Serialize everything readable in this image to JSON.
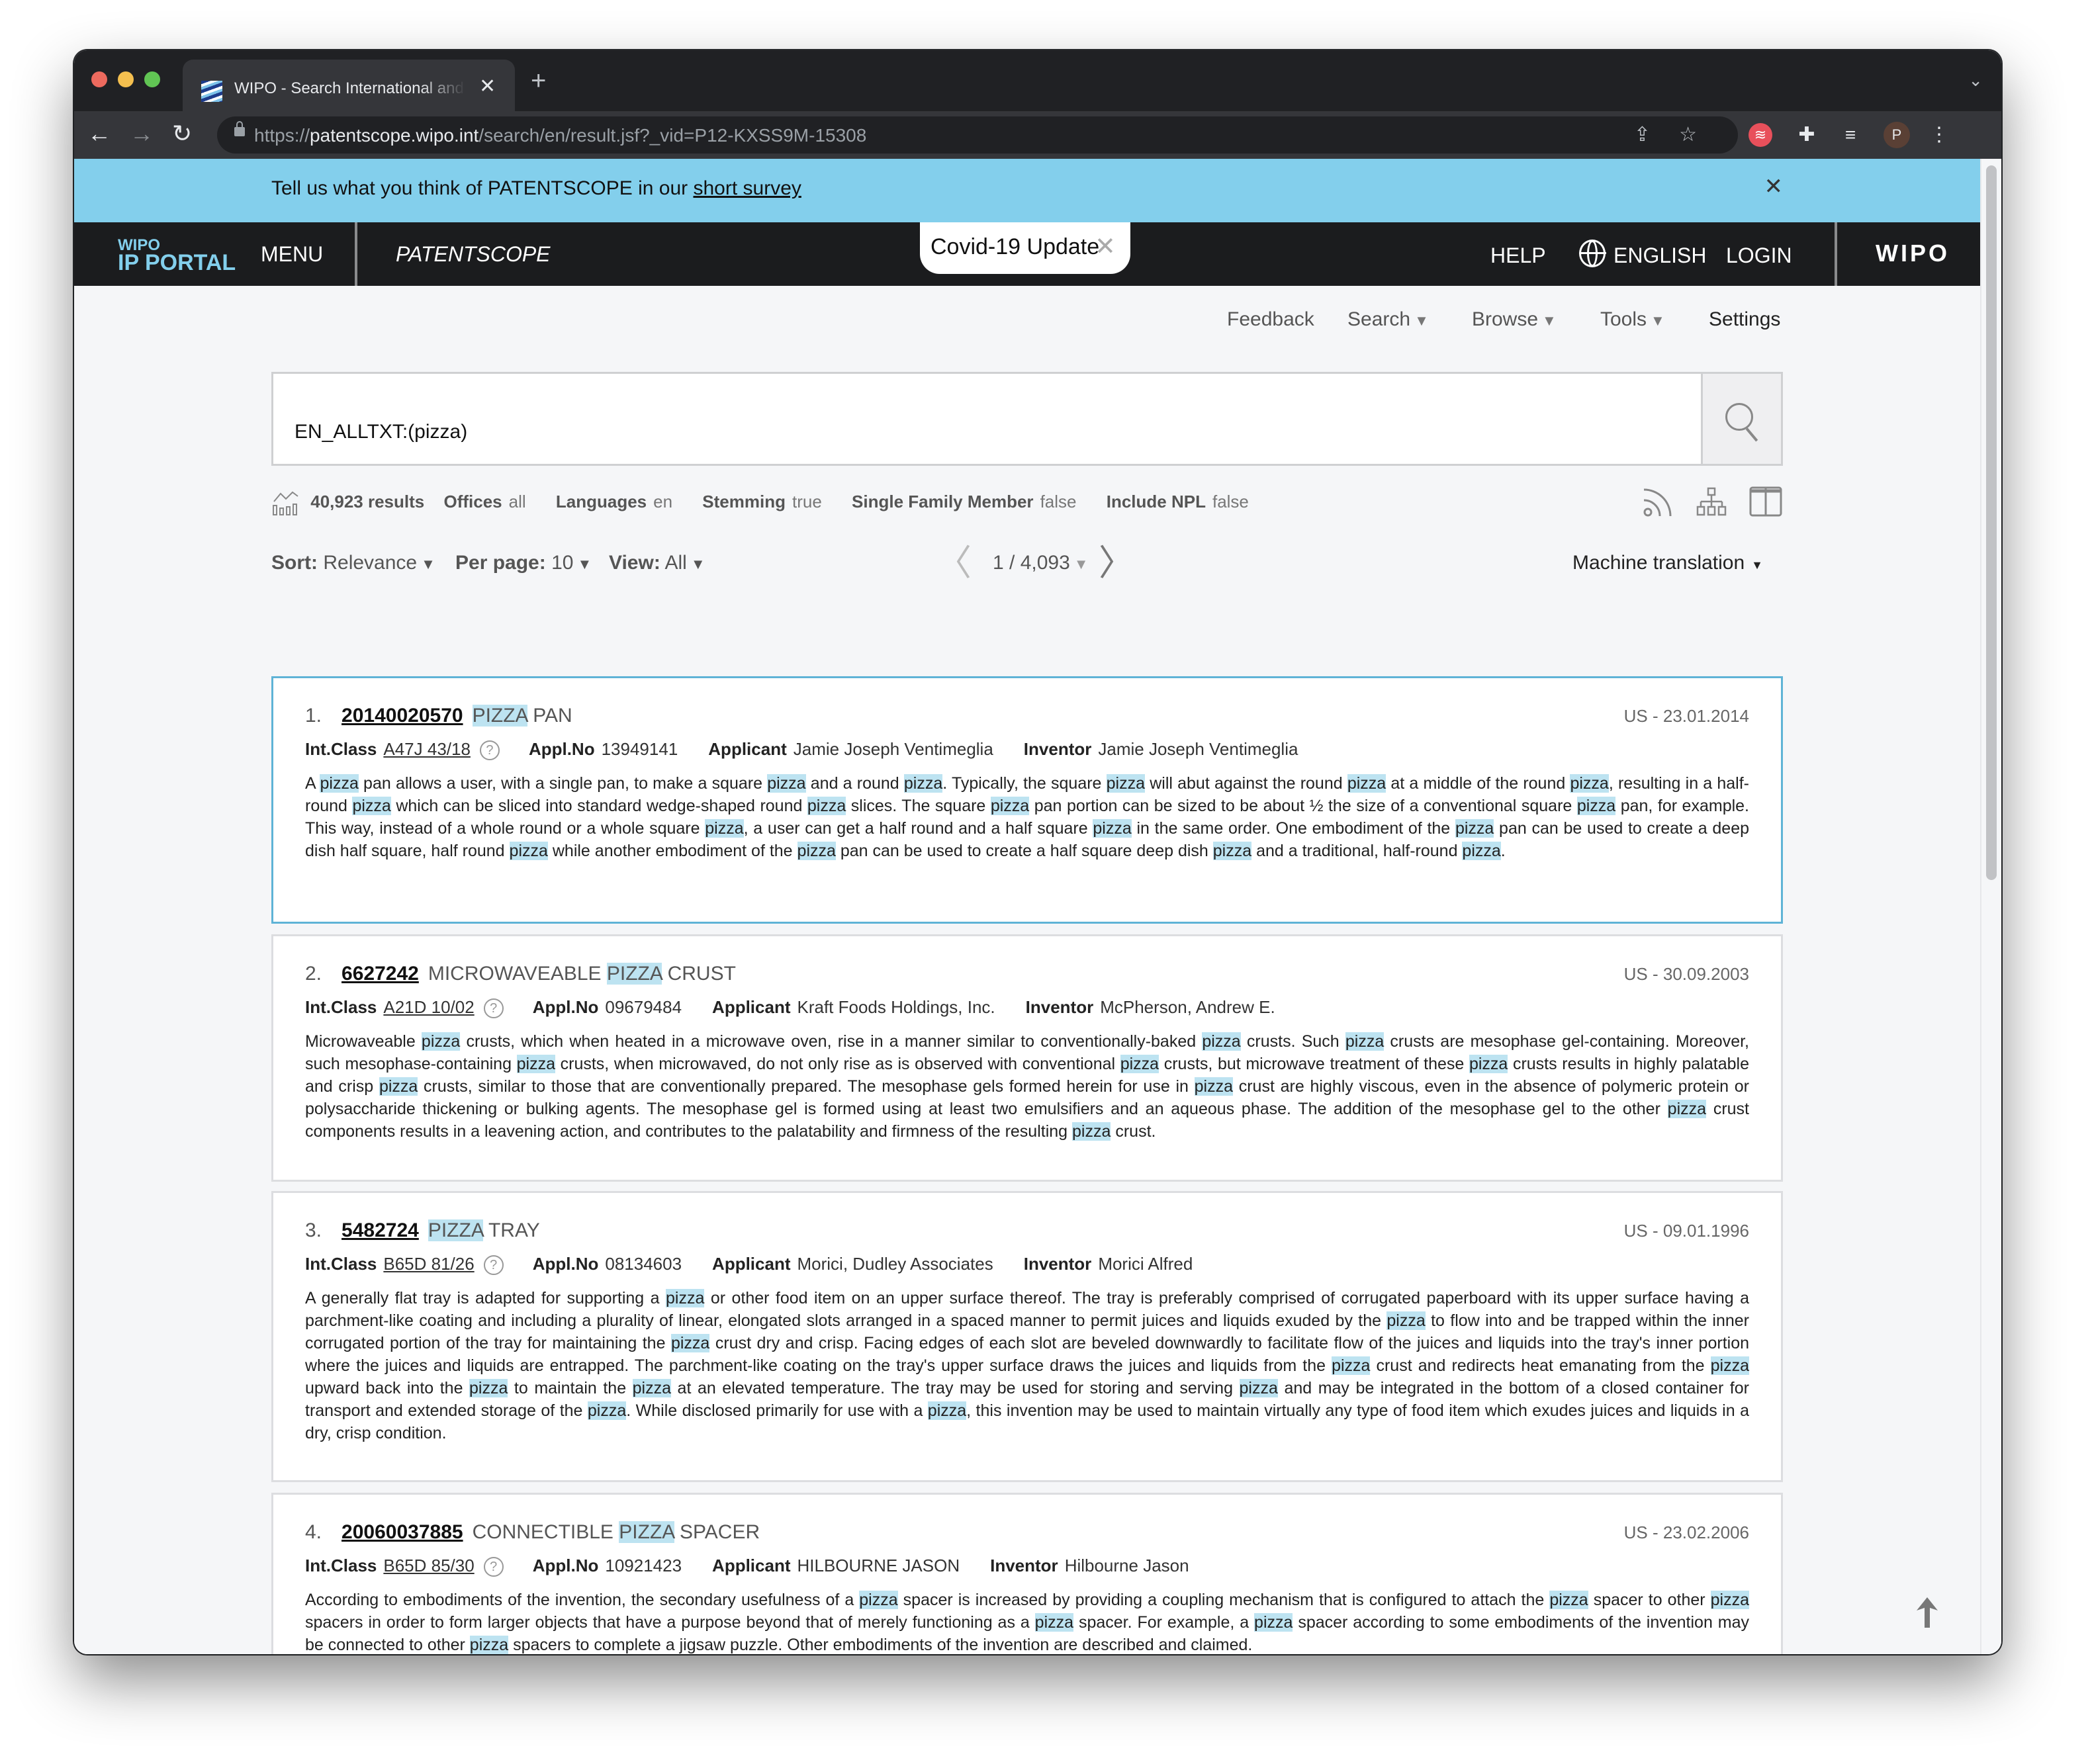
{
  "browser": {
    "tab_title": "WIPO - Search International and National Patent Collections",
    "url_scheme": "https://",
    "url_host": "patentscope.wipo.int",
    "url_path": "/search/en/result.jsf?_vid=P12-KXSS9M-15308",
    "profile_initial": "P"
  },
  "survey_banner": {
    "text": "Tell us what you think of PATENTSCOPE in our ",
    "link": "short survey"
  },
  "portal": {
    "logo_small": "WIPO",
    "logo_large": "IP PORTAL",
    "menu": "MENU",
    "product": "PATENTSCOPE",
    "covid": "Covid-19 Update",
    "help": "HELP",
    "language": "ENGLISH",
    "login": "LOGIN",
    "brand": "WIPO"
  },
  "subnav": {
    "feedback": "Feedback",
    "search": "Search",
    "browse": "Browse",
    "tools": "Tools",
    "settings": "Settings"
  },
  "search": {
    "query": "EN_ALLTXT:(pizza)"
  },
  "stats": {
    "results": "40,923 results",
    "offices_label": "Offices",
    "offices_value": "all",
    "languages_label": "Languages",
    "languages_value": "en",
    "stemming_label": "Stemming",
    "stemming_value": "true",
    "family_label": "Single Family Member",
    "family_value": "false",
    "npl_label": "Include NPL",
    "npl_value": "false"
  },
  "controls": {
    "sort_label": "Sort:",
    "sort_value": "Relevance",
    "perpage_label": "Per page:",
    "perpage_value": "10",
    "view_label": "View:",
    "view_value": "All",
    "page": "1 / 4,093",
    "machine_translation": "Machine translation"
  },
  "results": [
    {
      "num": "1.",
      "pn": "20140020570",
      "title_pre": "",
      "title_hl": "PIZZA",
      "title_post": " PAN",
      "date": "US - 23.01.2014",
      "int_class": "A47J 43/18",
      "appl_no": "13949141",
      "applicant": "Jamie Joseph Ventimeglia",
      "inventor": "Jamie Joseph Ventimeglia",
      "abstract": "A pizza pan allows a user, with a single pan, to make a square pizza and a round pizza. Typically, the square pizza will abut against the round pizza at a middle of the round pizza, resulting in a half-round pizza which can be sliced into standard wedge-shaped round pizza slices. The square pizza pan portion can be sized to be about ½ the size of a conventional square pizza pan, for example. This way, instead of a whole round or a whole square pizza, a user can get a half round and a half square pizza in the same order. One embodiment of the pizza pan can be used to create a deep dish half square, half round pizza while another embodiment of the pizza pan can be used to create a half square deep dish pizza and a traditional, half-round pizza."
    },
    {
      "num": "2.",
      "pn": "6627242",
      "title_pre": "MICROWAVEABLE ",
      "title_hl": "PIZZA",
      "title_post": " CRUST",
      "date": "US - 30.09.2003",
      "int_class": "A21D 10/02",
      "appl_no": "09679484",
      "applicant": "Kraft Foods Holdings, Inc.",
      "inventor": "McPherson, Andrew E.",
      "abstract": "Microwaveable pizza crusts, which when heated in a microwave oven, rise in a manner similar to conventionally-baked pizza crusts. Such pizza crusts are mesophase gel-containing. Moreover, such mesophase-containing pizza crusts, when microwaved, do not only rise as is observed with conventional pizza crusts, but microwave treatment of these pizza crusts results in highly palatable and crisp pizza crusts, similar to those that are conventionally prepared. The mesophase gels formed herein for use in pizza crust are highly viscous, even in the absence of polymeric protein or polysaccharide thickening or bulking agents. The mesophase gel is formed using at least two emulsifiers and an aqueous phase. The addition of the mesophase gel to the other pizza crust components results in a leavening action, and contributes to the palatability and firmness of the resulting pizza crust."
    },
    {
      "num": "3.",
      "pn": "5482724",
      "title_pre": "",
      "title_hl": "PIZZA",
      "title_post": " TRAY",
      "date": "US - 09.01.1996",
      "int_class": "B65D 81/26",
      "appl_no": "08134603",
      "applicant": "Morici, Dudley Associates",
      "inventor": "Morici Alfred",
      "abstract": "A generally flat tray is adapted for supporting a pizza or other food item on an upper surface thereof. The tray is preferably comprised of corrugated paperboard with its upper surface having a parchment-like coating and including a plurality of linear, elongated slots arranged in a spaced manner to permit juices and liquids exuded by the pizza to flow into and be trapped within the inner corrugated portion of the tray for maintaining the pizza crust dry and crisp. Facing edges of each slot are beveled downwardly to facilitate flow of the juices and liquids into the tray's inner portion where the juices and liquids are entrapped. The parchment-like coating on the tray's upper surface draws the juices and liquids from the pizza crust and redirects heat emanating from the pizza upward back into the pizza to maintain the pizza at an elevated temperature. The tray may be used for storing and serving pizza and may be integrated in the bottom of a closed container for transport and extended storage of the pizza. While disclosed primarily for use with a pizza, this invention may be used to maintain virtually any type of food item which exudes juices and liquids in a dry, crisp condition."
    },
    {
      "num": "4.",
      "pn": "20060037885",
      "title_pre": "CONNECTIBLE ",
      "title_hl": "PIZZA",
      "title_post": " SPACER",
      "date": "US - 23.02.2006",
      "int_class": "B65D 85/30",
      "appl_no": "10921423",
      "applicant": "HILBOURNE JASON",
      "inventor": "Hilbourne Jason",
      "abstract": "According to embodiments of the invention, the secondary usefulness of a pizza spacer is increased by providing a coupling mechanism that is configured to attach the pizza spacer to other pizza spacers in order to form larger objects that have a purpose beyond that of merely functioning as a pizza spacer. For example, a pizza spacer according to some embodiments of the invention may be connected to other pizza spacers to complete a jigsaw puzzle. Other embodiments of the invention are described and claimed."
    }
  ],
  "labels": {
    "int_class": "Int.Class",
    "appl_no": "Appl.No",
    "applicant": "Applicant",
    "inventor": "Inventor",
    "help_mark": "?"
  },
  "highlight_term": "pizza",
  "colors": {
    "banner": "#83cfec",
    "portal_bar": "#1b1c1e",
    "highlight": "#bde3f1",
    "active_border": "#5fb3d6"
  }
}
